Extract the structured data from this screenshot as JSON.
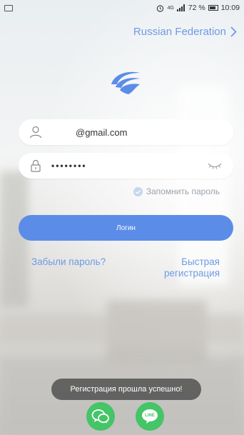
{
  "status_bar": {
    "network": "4G",
    "battery_percent": "72 %",
    "time": "10:09"
  },
  "region": {
    "label": "Russian Federation"
  },
  "login_form": {
    "email_value": "@gmail.com",
    "password_value": "••••••••",
    "remember_label": "Запомнить пароль",
    "remember_checked": true,
    "login_button": "Логин"
  },
  "links": {
    "forgot_password": "Забыли пароль?",
    "quick_register_line1": "Быстрая",
    "quick_register_line2": "регистрация"
  },
  "toast": {
    "message": "Регистрация прошла успешно!"
  },
  "social": {
    "line_label": "LINE",
    "icons": [
      "wechat-icon",
      "line-icon"
    ]
  },
  "colors": {
    "accent": "#5b8de8",
    "link": "#6e9be3",
    "social_green": "#45c468",
    "toast_bg": "#5a5a5a"
  }
}
